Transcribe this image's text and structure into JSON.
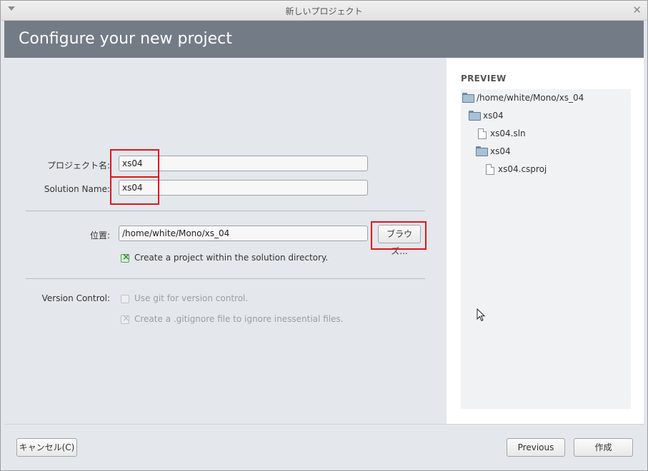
{
  "window": {
    "title": "新しいプロジェクト",
    "header": "Configure your new project"
  },
  "form": {
    "project_name_label": "プロジェクト名:",
    "project_name_value": "xs04",
    "solution_name_label": "Solution Name:",
    "solution_name_value": "xs04",
    "location_label": "位置:",
    "location_value": "/home/white/Mono/xs_04",
    "browse_label": "ブラウズ...",
    "create_within_solution_label": "Create a project within the solution directory.",
    "create_within_solution_checked": true,
    "version_control_label": "Version Control:",
    "use_git_label": "Use git for version control.",
    "use_git_checked": false,
    "gitignore_label": "Create a .gitignore file to ignore inessential files.",
    "gitignore_checked": true
  },
  "preview": {
    "title": "PREVIEW",
    "tree": [
      {
        "type": "folder",
        "label": "/home/white/Mono/xs_04",
        "depth": 0
      },
      {
        "type": "folder",
        "label": "xs04",
        "depth": 1
      },
      {
        "type": "file",
        "label": "xs04.sln",
        "depth": 2
      },
      {
        "type": "folder",
        "label": "xs04",
        "depth": 2
      },
      {
        "type": "file",
        "label": "xs04.csproj",
        "depth": 3
      }
    ]
  },
  "footer": {
    "cancel_label": "キャンセル(C)",
    "previous_label": "Previous",
    "create_label": "作成"
  },
  "icons": {
    "menu": "chevron-down-icon",
    "close": "close-icon",
    "folder": "folder-icon",
    "file": "file-icon",
    "cursor": "mouse-pointer-icon"
  }
}
